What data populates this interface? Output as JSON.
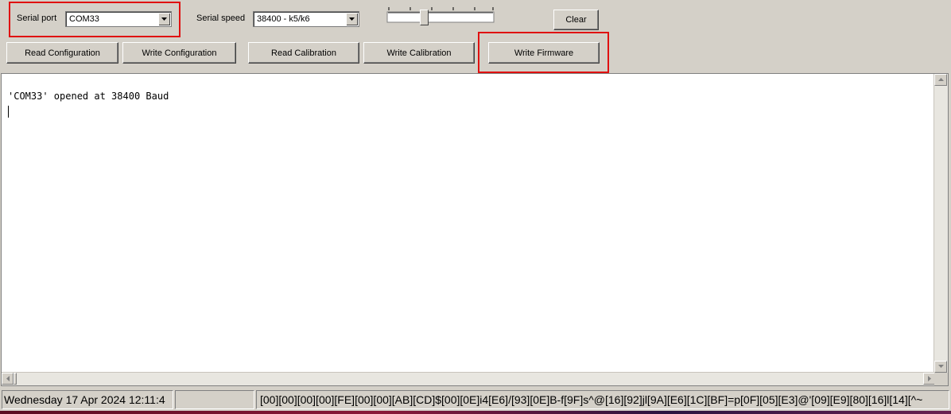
{
  "toolbar": {
    "serial_port_label": "Serial port",
    "serial_port_value": "COM33",
    "serial_speed_label": "Serial speed",
    "serial_speed_value": "38400 - k5/k6",
    "clear_label": "Clear",
    "slider_level": 0.33
  },
  "buttons": {
    "read_configuration": "Read Configuration",
    "write_configuration": "Write Configuration",
    "read_calibration": "Read Calibration",
    "write_calibration": "Write Calibration",
    "write_firmware": "Write Firmware"
  },
  "console": {
    "line1": "'COM33' opened at 38400 Baud"
  },
  "status": {
    "datetime": "Wednesday 17 Apr 2024  12:11:4",
    "data": "[00][00][00][00][FE][00][00][AB][CD]$[00][0E]i4[E6]/[93][0E]B-f[9F]s^@[16][92]jl[9A][E6][1C][BF]=p[0F][05][E3]@'[09][E9][80][16]l[14][^~"
  },
  "colors": {
    "highlight": "#e01010",
    "window_bg": "#d4d0c8"
  }
}
